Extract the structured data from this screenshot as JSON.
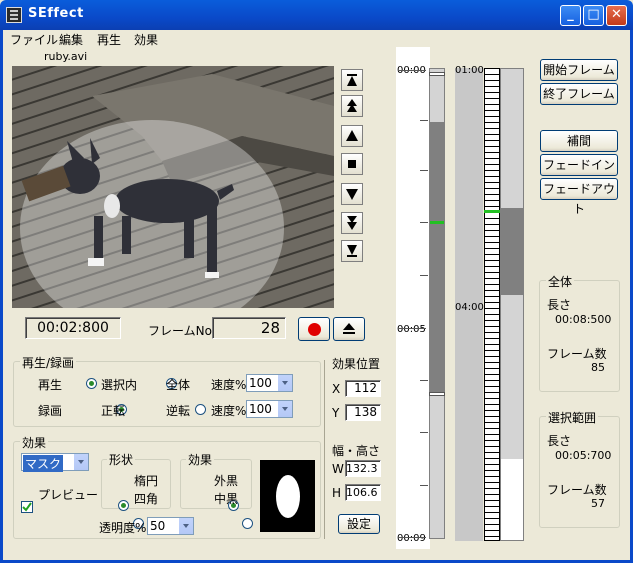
{
  "window": {
    "title": "SEffect"
  },
  "menu": {
    "file": "ファイル",
    "edit": "編集",
    "play": "再生",
    "effect": "効果"
  },
  "video": {
    "filename": "ruby.avi"
  },
  "playback": {
    "time": "00:02:800",
    "frame_label": "フレームNo.",
    "frame_no": "28"
  },
  "play_rec": {
    "title": "再生/録画",
    "play_label": "再生",
    "play_opt1": "選択内",
    "play_opt2": "全体",
    "speed_label": "速度%",
    "play_speed": "100",
    "rec_label": "録画",
    "rec_opt1": "正転",
    "rec_opt2": "逆転",
    "rec_speed": "100"
  },
  "effect": {
    "title": "効果",
    "type_value": "マスク",
    "preview_label": "プレビュー",
    "shape_title": "形状",
    "shape_opt1": "楕円",
    "shape_opt2": "四角",
    "effect_title": "効果",
    "effect_opt1": "外黒",
    "effect_opt2": "中黒",
    "opacity_label": "透明度%",
    "opacity_value": "50"
  },
  "position": {
    "title": "効果位置",
    "x_label": "X",
    "x_value": "112",
    "y_label": "Y",
    "y_value": "138",
    "size_title": "幅・高さ",
    "w_label": "W",
    "w_value": "132.3",
    "h_label": "H",
    "h_value": "106.6",
    "set_button": "設定"
  },
  "timeline": {
    "left_time_top": "00:00",
    "left_time_mid": "00:05",
    "left_time_bottom": "00:09",
    "right_time_top": "01:00",
    "right_time_mid": "04:00"
  },
  "buttons": {
    "start_frame": "開始フレーム",
    "end_frame": "終了フレーム",
    "interpolate": "補間",
    "fade_in": "フェードイン",
    "fade_out": "フェードアウト"
  },
  "total": {
    "title": "全体",
    "length_label": "長さ",
    "length_value": "00:08:500",
    "frames_label": "フレーム数",
    "frames_value": "85"
  },
  "selection": {
    "title": "選択範囲",
    "length_label": "長さ",
    "length_value": "00:05:700",
    "frames_label": "フレーム数",
    "frames_value": "57"
  },
  "colors": {
    "titlebar": "#0a49c9",
    "accent_green": "#22c022",
    "record_red": "#e00000"
  }
}
